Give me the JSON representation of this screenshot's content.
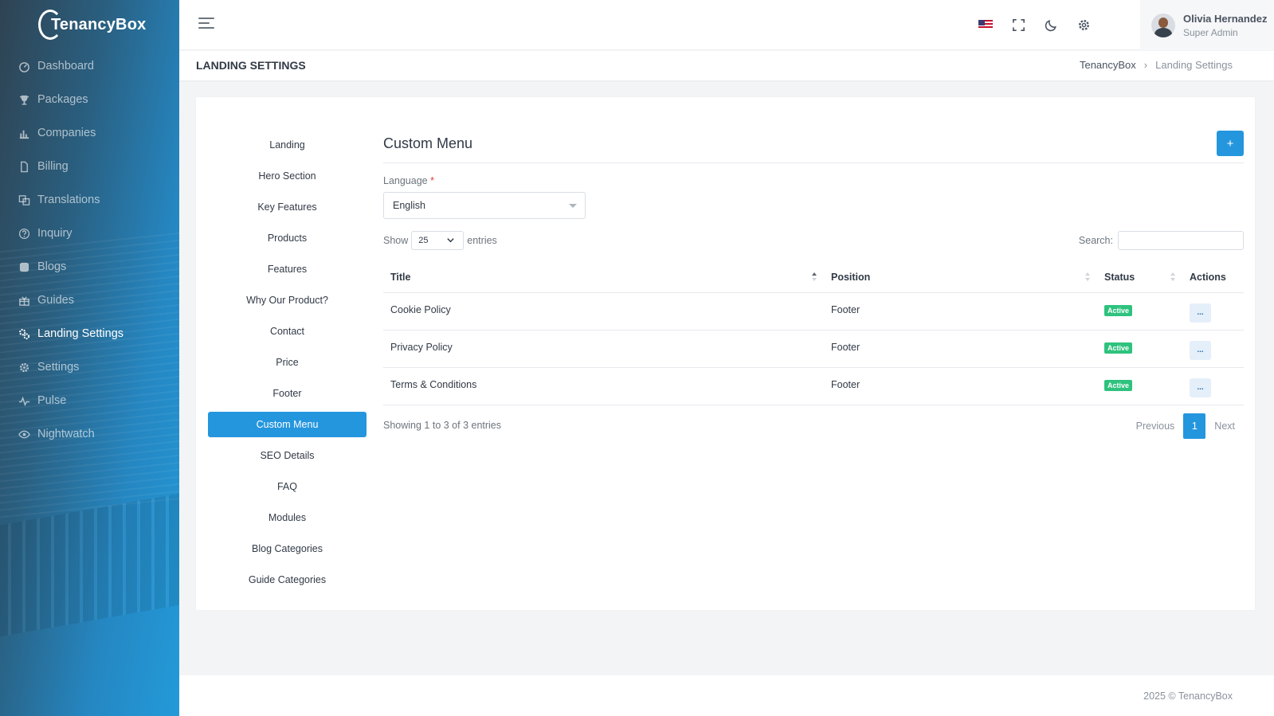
{
  "brand": {
    "name": "TenancyBox"
  },
  "sidebar": {
    "items": [
      {
        "label": "Dashboard",
        "icon": "dashboard-icon"
      },
      {
        "label": "Packages",
        "icon": "trophy-icon"
      },
      {
        "label": "Companies",
        "icon": "bar-chart-icon"
      },
      {
        "label": "Billing",
        "icon": "file-icon"
      },
      {
        "label": "Translations",
        "icon": "translate-icon"
      },
      {
        "label": "Inquiry",
        "icon": "help-circle-icon"
      },
      {
        "label": "Blogs",
        "icon": "blog-icon"
      },
      {
        "label": "Guides",
        "icon": "gift-icon"
      },
      {
        "label": "Landing Settings",
        "icon": "cogs-icon",
        "active": true
      },
      {
        "label": "Settings",
        "icon": "gear-icon"
      },
      {
        "label": "Pulse",
        "icon": "pulse-icon"
      },
      {
        "label": "Nightwatch",
        "icon": "eye-icon"
      }
    ]
  },
  "topbar": {
    "icons": [
      "us-flag-icon",
      "fullscreen-icon",
      "moon-icon",
      "gear-icon"
    ],
    "user": {
      "name": "Olivia Hernandez",
      "role": "Super Admin"
    }
  },
  "page": {
    "title": "LANDING SETTINGS",
    "breadcrumb": [
      "TenancyBox",
      "Landing Settings"
    ]
  },
  "subnav": {
    "items": [
      "Landing",
      "Hero Section",
      "Key Features",
      "Products",
      "Features",
      "Why Our Product?",
      "Contact",
      "Price",
      "Footer",
      "Custom Menu",
      "SEO Details",
      "FAQ",
      "Modules",
      "Blog Categories",
      "Guide Categories"
    ],
    "active": "Custom Menu"
  },
  "content": {
    "title": "Custom Menu",
    "add_label": "+",
    "language_label": "Language",
    "required_mark": "*",
    "language_value": "English",
    "show_label": "Show",
    "entries_value": "25",
    "entries_label": "entries",
    "search_label": "Search:",
    "search_value": "",
    "columns": [
      "Title",
      "Position",
      "Status",
      "Actions"
    ],
    "rows": [
      {
        "title": "Cookie Policy",
        "position": "Footer",
        "status": "Active",
        "action": "..."
      },
      {
        "title": "Privacy Policy",
        "position": "Footer",
        "status": "Active",
        "action": "..."
      },
      {
        "title": "Terms & Conditions",
        "position": "Footer",
        "status": "Active",
        "action": "..."
      }
    ],
    "info": "Showing 1 to 3 of 3 entries",
    "pagination": {
      "previous": "Previous",
      "current": "1",
      "next": "Next"
    }
  },
  "footer": {
    "text": "2025 © TenancyBox"
  },
  "colors": {
    "accent": "#2496de",
    "active_badge": "#2ec27e"
  }
}
